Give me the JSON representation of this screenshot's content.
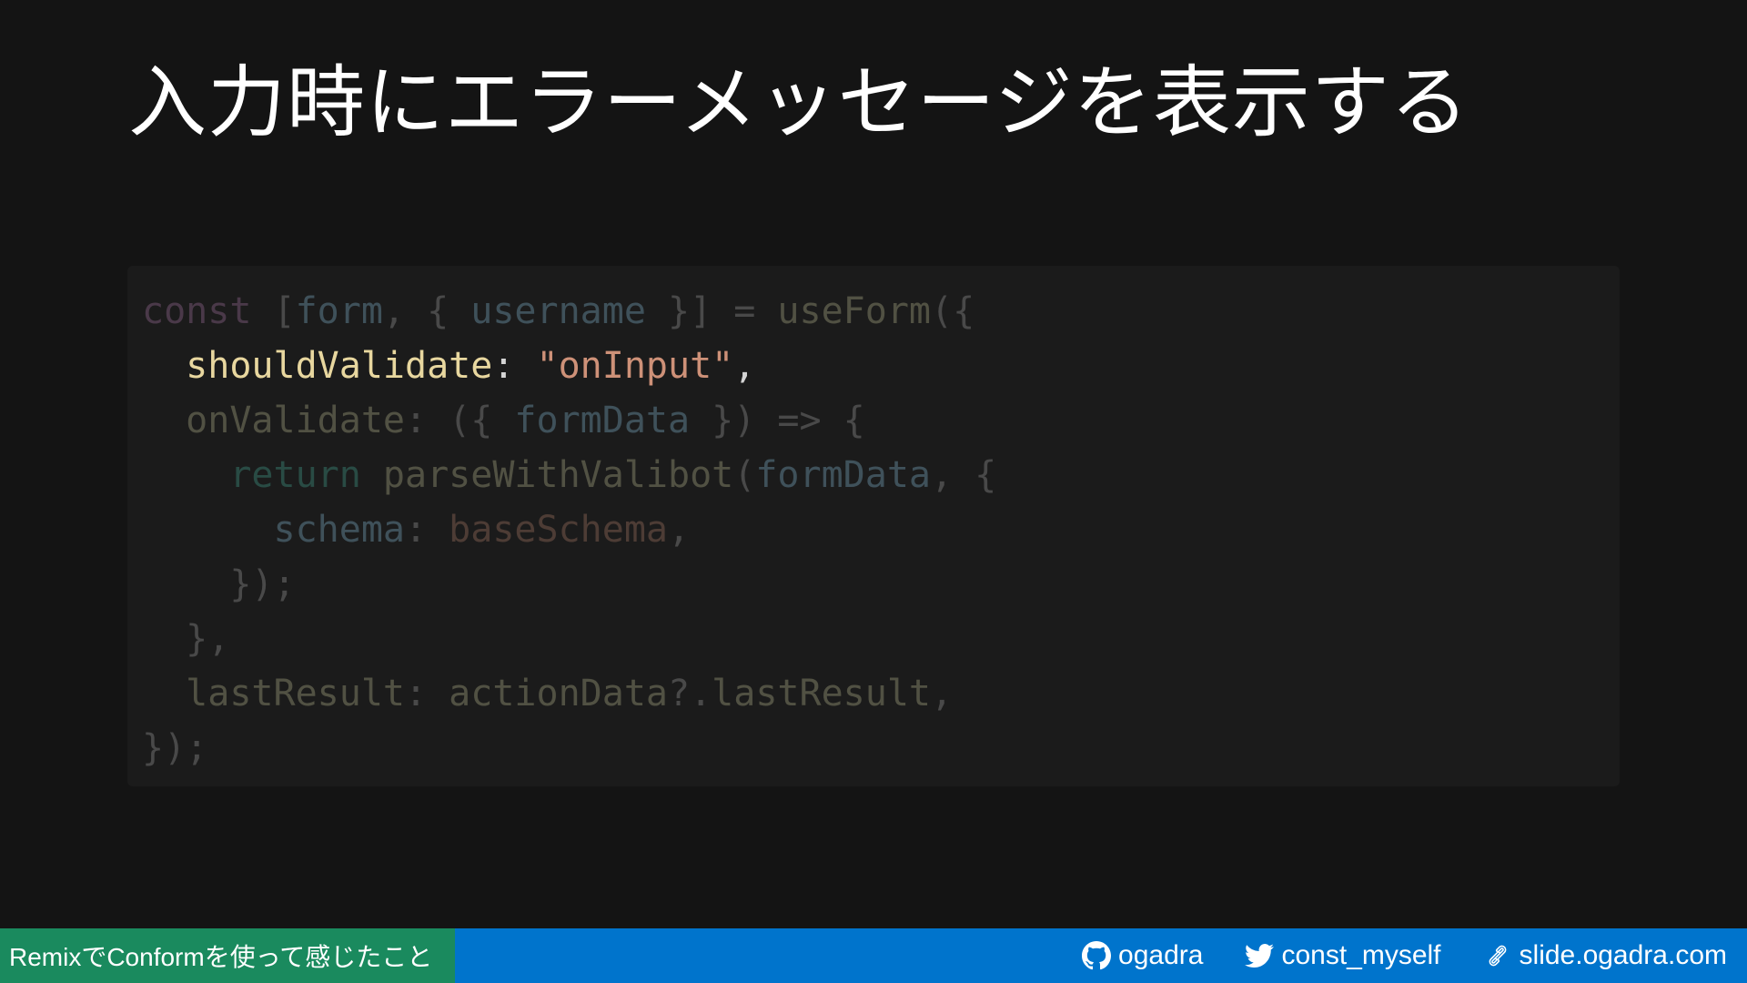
{
  "slide": {
    "title": "入力時にエラーメッセージを表示する"
  },
  "code": {
    "line1": {
      "kw": "const",
      "p1": " [",
      "form": "form",
      "p2": ", { ",
      "username": "username",
      "p3": " }] = ",
      "fn": "useForm",
      "p4": "({"
    },
    "line2": {
      "indent": "  ",
      "prop": "shouldValidate",
      "colon": ": ",
      "str": "\"onInput\"",
      "comma": ","
    },
    "line3": {
      "indent": "  ",
      "prop": "onValidate",
      "p1": ": ({ ",
      "arg": "formData",
      "p2": " }) => {"
    },
    "line4": {
      "indent": "    ",
      "kw": "return",
      "sp": " ",
      "fn": "parseWithValibot",
      "p1": "(",
      "arg": "formData",
      "p2": ", {"
    },
    "line5": {
      "indent": "      ",
      "prop": "schema",
      "p1": ": ",
      "val": "baseSchema",
      "p2": ","
    },
    "line6": {
      "text": "    });"
    },
    "line7": {
      "text": "  },"
    },
    "line8": {
      "indent": "  ",
      "prop": "lastResult",
      "p1": ": ",
      "obj": "actionData",
      "p2": "?.",
      "val": "lastResult",
      "p3": ","
    },
    "line9": {
      "text": "});"
    }
  },
  "footer": {
    "title": "RemixでConformを使って感じたこと",
    "github": "ogadra",
    "twitter": "const_myself",
    "website": "slide.ogadra.com"
  },
  "colors": {
    "background": "#141414",
    "code_background": "#1b1b1b",
    "footer_blue": "#0074cc",
    "footer_green": "#1a8a5e"
  },
  "icons": {
    "github": "github-icon",
    "twitter": "twitter-icon",
    "link": "link-icon"
  }
}
